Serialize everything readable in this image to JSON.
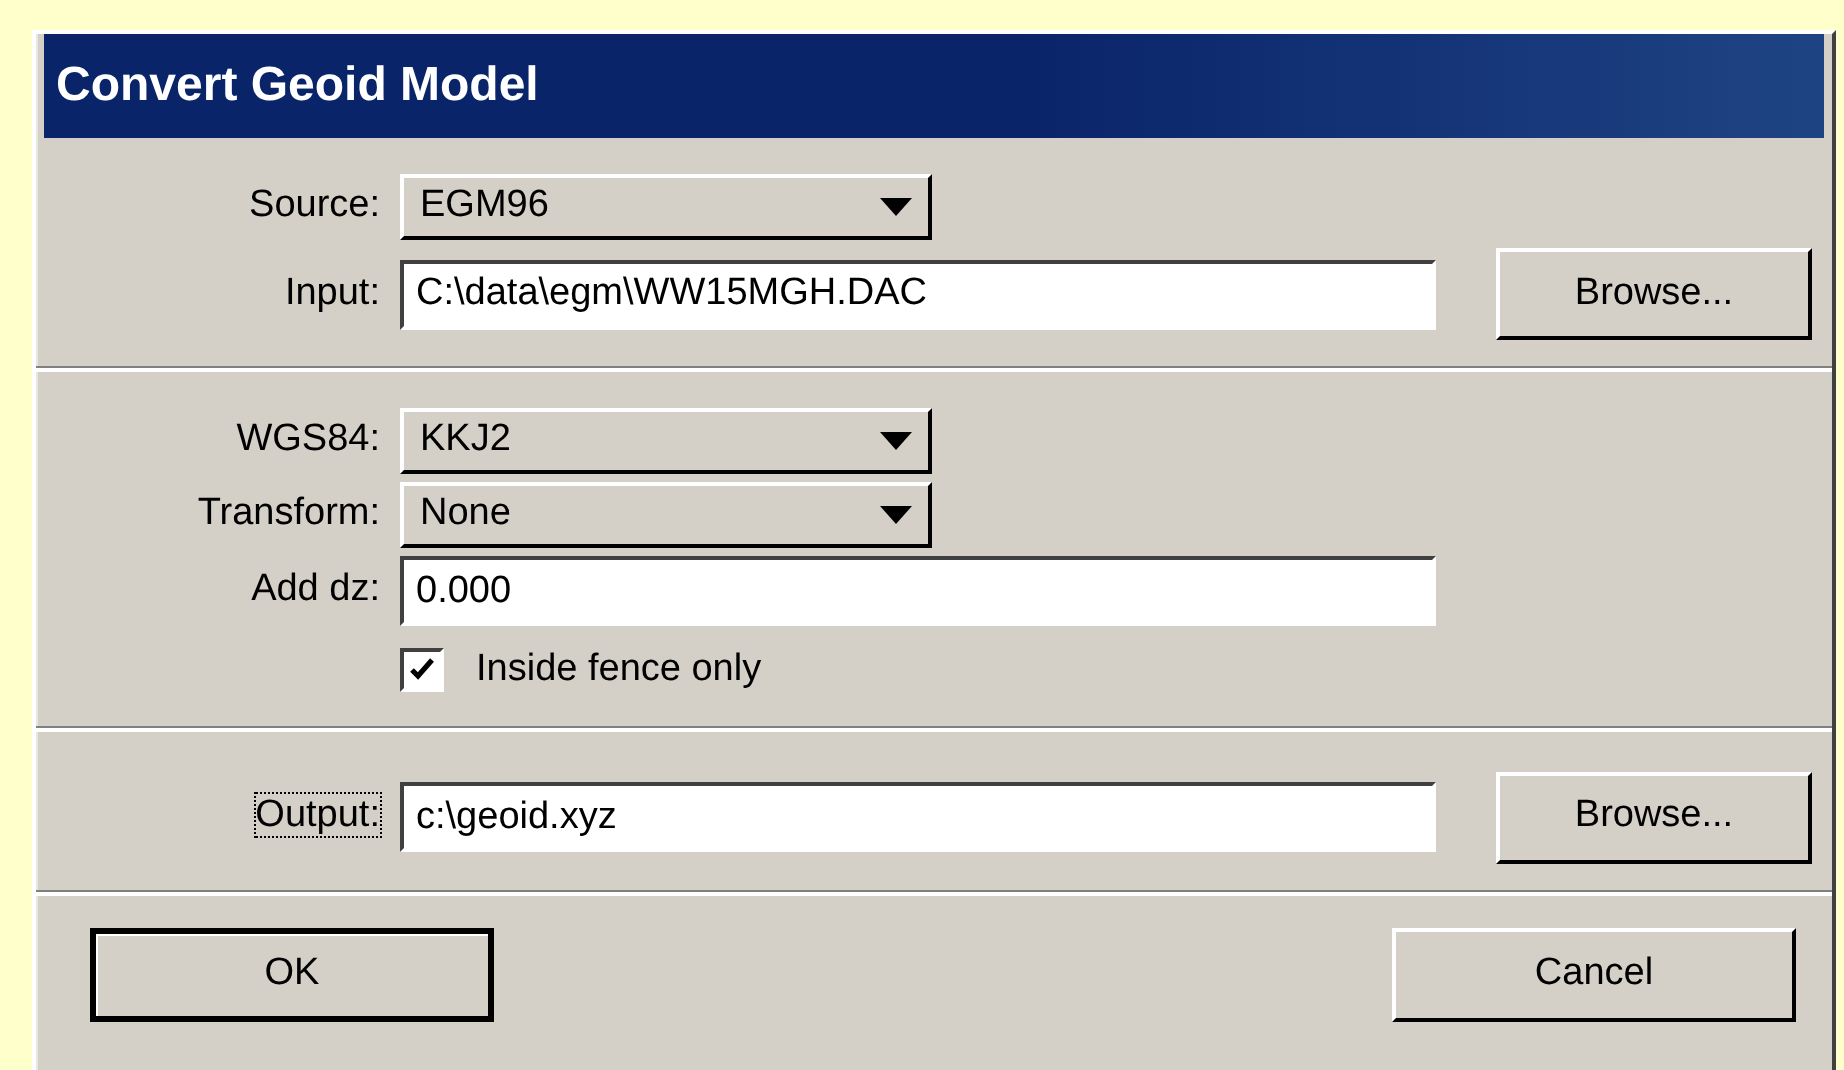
{
  "window": {
    "title": "Convert Geoid Model"
  },
  "sections": [
    {
      "rows": [
        {
          "kind": "combo",
          "label": "Source:",
          "value": "EGM96"
        },
        {
          "kind": "field",
          "label": "Input:",
          "value": "C:\\data\\egm\\WW15MGH.DAC",
          "button": "Browse..."
        }
      ]
    },
    {
      "rows": [
        {
          "kind": "combo",
          "label": "WGS84:",
          "value": "KKJ2"
        },
        {
          "kind": "combo",
          "label": "Transform:",
          "value": "None"
        },
        {
          "kind": "field",
          "label": "Add dz:",
          "value": "0.000"
        },
        {
          "kind": "checkbox",
          "label": "Inside fence only",
          "checked": true
        }
      ]
    },
    {
      "rows": [
        {
          "kind": "field",
          "label": "Output:",
          "value": "c:\\geoid.xyz",
          "focused": true,
          "button": "Browse..."
        }
      ]
    }
  ],
  "buttons": [
    {
      "label": "OK",
      "default": true
    },
    {
      "label": "Cancel",
      "default": false
    }
  ]
}
